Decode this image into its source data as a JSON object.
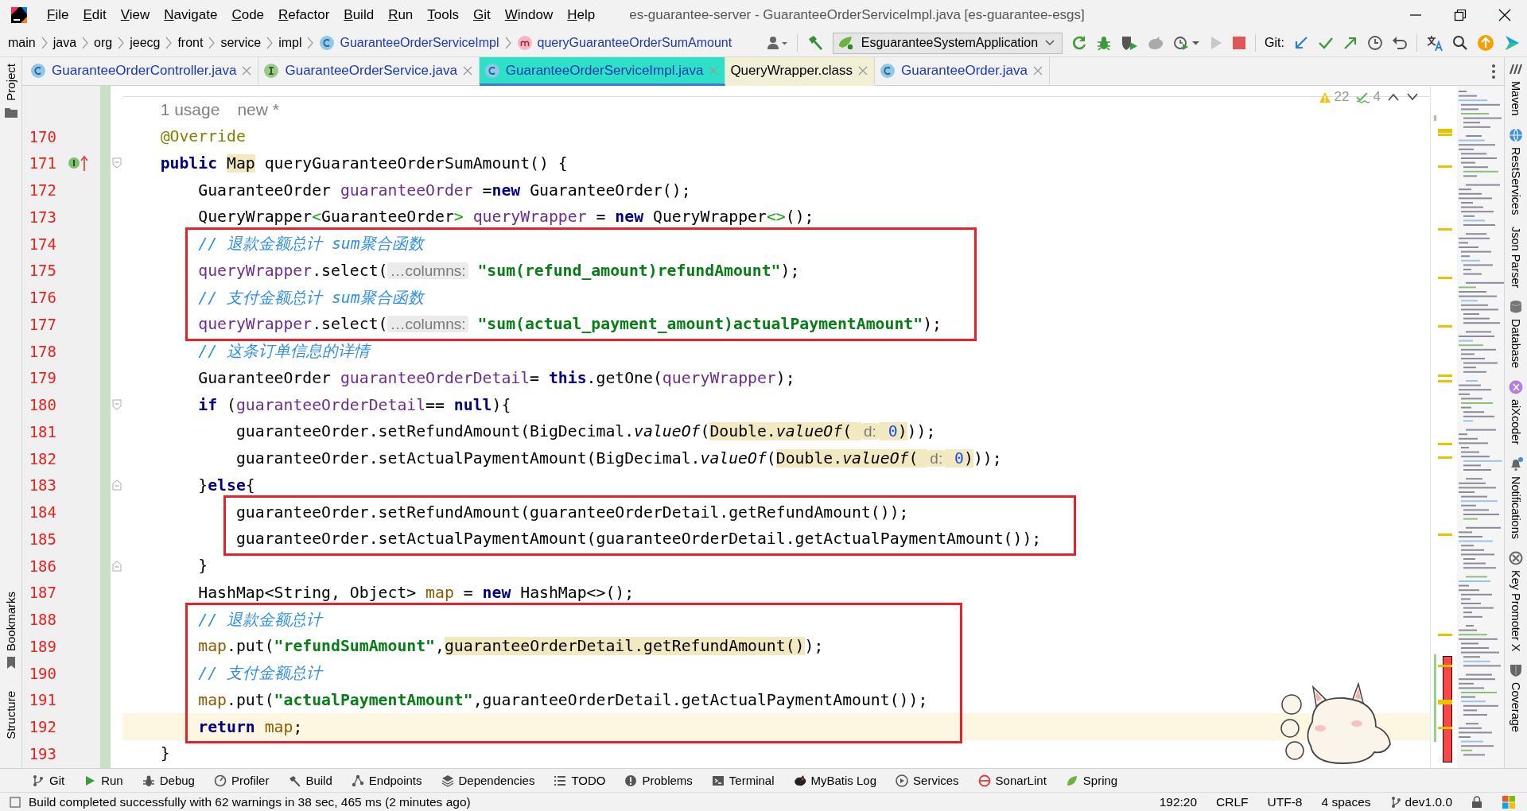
{
  "title_bar": {
    "menu": [
      "File",
      "Edit",
      "View",
      "Navigate",
      "Code",
      "Refactor",
      "Build",
      "Run",
      "Tools",
      "Git",
      "Window",
      "Help"
    ],
    "title": "es-guarantee-server - GuaranteeOrderServiceImpl.java [es-guarantee-esgs]"
  },
  "nav_bar": {
    "breadcrumbs": [
      {
        "label": "main",
        "kind": "package"
      },
      {
        "label": "java",
        "kind": "package"
      },
      {
        "label": "org",
        "kind": "package"
      },
      {
        "label": "jeecg",
        "kind": "package"
      },
      {
        "label": "front",
        "kind": "package"
      },
      {
        "label": "service",
        "kind": "package"
      },
      {
        "label": "impl",
        "kind": "package"
      },
      {
        "label": "GuaranteeOrderServiceImpl",
        "kind": "class"
      },
      {
        "label": "queryGuaranteeOrderSumAmount",
        "kind": "method"
      }
    ],
    "run_configuration": "EsguaranteeSystemApplication",
    "git_label": "Git:"
  },
  "tabs": [
    {
      "label": "GuaranteeOrderController.java",
      "kind": "class",
      "selected": false
    },
    {
      "label": "GuaranteeOrderService.java",
      "kind": "interface",
      "selected": false
    },
    {
      "label": "GuaranteeOrderServiceImpl.java",
      "kind": "class",
      "selected": true
    },
    {
      "label": "QueryWrapper.class",
      "kind": "library",
      "selected": false
    },
    {
      "label": "GuaranteeOrder.java",
      "kind": "class",
      "selected": false
    }
  ],
  "left_tool_windows": {
    "top": [
      {
        "label": "Project",
        "kind": "folder"
      }
    ],
    "bottom": [
      {
        "label": "Bookmarks",
        "kind": "bookmark"
      },
      {
        "label": "Structure",
        "kind": "plain"
      }
    ]
  },
  "right_tool_windows": [
    {
      "label": "Maven",
      "kind": "maven"
    },
    {
      "label": "RestServices",
      "kind": "globe"
    },
    {
      "label": "Json Parser",
      "kind": "plain"
    },
    {
      "label": "Database",
      "kind": "database"
    },
    {
      "label": "aiXcoder",
      "kind": "aix"
    },
    {
      "label": "Notifications",
      "kind": "bell"
    },
    {
      "label": "Key Promoter X",
      "kind": "key"
    },
    {
      "label": "Coverage",
      "kind": "shield"
    }
  ],
  "editor": {
    "inspections": {
      "warnings": "22",
      "weak_warnings": "4"
    },
    "usage_hint": [
      "1 usage",
      "new *"
    ],
    "code_blocks": [
      {
        "boxed": false,
        "lines": [
          {
            "number": "170",
            "kind": "plain",
            "current": false,
            "tokens": [
              {
                "kind": "annotation",
                "text": "    @Override"
              }
            ]
          },
          {
            "number": "171",
            "kind": "implements",
            "current": false,
            "tokens": [
              {
                "kind": "keyword",
                "text": "    public "
              },
              {
                "kind": "plain",
                "text": "Map",
                "highlighted": true
              },
              {
                "kind": "plain",
                "text": " queryGuaranteeOrderSumAmount() {"
              }
            ]
          },
          {
            "number": "172",
            "kind": "plain",
            "current": false,
            "tokens": [
              {
                "kind": "plain",
                "text": "        GuaranteeOrder "
              },
              {
                "kind": "variable",
                "text": "guaranteeOrder"
              },
              {
                "kind": "plain",
                "text": " ="
              },
              {
                "kind": "keyword",
                "text": "new"
              },
              {
                "kind": "plain",
                "text": " GuaranteeOrder();"
              }
            ]
          },
          {
            "number": "173",
            "kind": "plain",
            "current": false,
            "tokens": [
              {
                "kind": "plain",
                "text": "        QueryWrapper"
              },
              {
                "kind": "generic",
                "text": "<"
              },
              {
                "kind": "plain",
                "text": "GuaranteeOrder"
              },
              {
                "kind": "generic",
                "text": "> "
              },
              {
                "kind": "variable",
                "text": "queryWrapper"
              },
              {
                "kind": "plain",
                "text": " = "
              },
              {
                "kind": "keyword",
                "text": "new"
              },
              {
                "kind": "plain",
                "text": " QueryWrapper"
              },
              {
                "kind": "generic",
                "text": "<>"
              },
              {
                "kind": "plain",
                "text": "();"
              }
            ]
          }
        ]
      },
      {
        "boxed": true,
        "lines": [
          {
            "number": "174",
            "kind": "plain",
            "current": false,
            "tokens": [
              {
                "kind": "comment",
                "text": "        // 退款金额总计 sum聚合函数"
              }
            ]
          },
          {
            "number": "175",
            "kind": "plain",
            "current": false,
            "tokens": [
              {
                "kind": "variable",
                "text": "        queryWrapper"
              },
              {
                "kind": "plain",
                "text": ".select("
              },
              {
                "kind": "hint",
                "text": "…columns:"
              },
              {
                "kind": "string",
                "text": " \"sum(refund_amount)refundAmount\""
              },
              {
                "kind": "plain",
                "text": ");"
              }
            ]
          },
          {
            "number": "176",
            "kind": "plain",
            "current": false,
            "tokens": [
              {
                "kind": "comment",
                "text": "        // 支付金额总计 sum聚合函数"
              }
            ]
          },
          {
            "number": "177",
            "kind": "plain",
            "current": false,
            "tokens": [
              {
                "kind": "variable",
                "text": "        queryWrapper"
              },
              {
                "kind": "plain",
                "text": ".select("
              },
              {
                "kind": "hint",
                "text": "…columns:"
              },
              {
                "kind": "string",
                "text": " \"sum(actual_payment_amount)actualPaymentAmount\""
              },
              {
                "kind": "plain",
                "text": ");"
              }
            ]
          }
        ]
      },
      {
        "boxed": false,
        "lines": [
          {
            "number": "178",
            "kind": "plain",
            "current": false,
            "tokens": [
              {
                "kind": "comment",
                "text": "        // 这条订单信息的详情"
              }
            ]
          },
          {
            "number": "179",
            "kind": "plain",
            "current": false,
            "tokens": [
              {
                "kind": "plain",
                "text": "        GuaranteeOrder "
              },
              {
                "kind": "variable",
                "text": "guaranteeOrderDetail"
              },
              {
                "kind": "plain",
                "text": "= "
              },
              {
                "kind": "keyword",
                "text": "this"
              },
              {
                "kind": "plain",
                "text": ".getOne("
              },
              {
                "kind": "variable",
                "text": "queryWrapper"
              },
              {
                "kind": "plain",
                "text": ");"
              }
            ]
          },
          {
            "number": "180",
            "kind": "fold_start",
            "current": false,
            "tokens": [
              {
                "kind": "keyword",
                "text": "        if"
              },
              {
                "kind": "plain",
                "text": " ("
              },
              {
                "kind": "variable",
                "text": "guaranteeOrderDetail"
              },
              {
                "kind": "plain",
                "text": "== "
              },
              {
                "kind": "keyword",
                "text": "null"
              },
              {
                "kind": "plain",
                "text": "){"
              }
            ]
          },
          {
            "number": "181",
            "kind": "plain",
            "current": false,
            "tokens": [
              {
                "kind": "plain",
                "text": "            guaranteeOrder.setRefundAmount(BigDecimal."
              },
              {
                "kind": "static",
                "text": "valueOf"
              },
              {
                "kind": "plain",
                "text": "("
              },
              {
                "kind": "plain",
                "text": "Double.",
                "highlighted": true
              },
              {
                "kind": "static",
                "text": "valueOf",
                "highlighted": true
              },
              {
                "kind": "plain",
                "text": "( ",
                "highlighted": true
              },
              {
                "kind": "hint",
                "text": "d:",
                "highlighted": true
              },
              {
                "kind": "number",
                "text": " 0",
                "highlighted": true
              },
              {
                "kind": "plain",
                "text": ")",
                "highlighted": true
              },
              {
                "kind": "plain",
                "text": "));"
              }
            ]
          },
          {
            "number": "182",
            "kind": "plain",
            "current": false,
            "tokens": [
              {
                "kind": "plain",
                "text": "            guaranteeOrder.setActualPaymentAmount(BigDecimal."
              },
              {
                "kind": "static",
                "text": "valueOf"
              },
              {
                "kind": "plain",
                "text": "("
              },
              {
                "kind": "plain",
                "text": "Double.",
                "highlighted": true
              },
              {
                "kind": "static",
                "text": "valueOf",
                "highlighted": true
              },
              {
                "kind": "plain",
                "text": "( ",
                "highlighted": true
              },
              {
                "kind": "hint",
                "text": "d:",
                "highlighted": true
              },
              {
                "kind": "number",
                "text": " 0",
                "highlighted": true
              },
              {
                "kind": "plain",
                "text": ")",
                "highlighted": true
              },
              {
                "kind": "plain",
                "text": "));"
              }
            ]
          },
          {
            "number": "183",
            "kind": "fold_end",
            "current": false,
            "tokens": [
              {
                "kind": "plain",
                "text": "        }"
              },
              {
                "kind": "keyword",
                "text": "else"
              },
              {
                "kind": "plain",
                "text": "{"
              }
            ]
          }
        ]
      },
      {
        "boxed": true,
        "lines": [
          {
            "number": "184",
            "kind": "plain",
            "current": false,
            "tokens": [
              {
                "kind": "plain",
                "text": "            guaranteeOrder.setRefundAmount(guaranteeOrderDetail.getRefundAmount());"
              }
            ]
          },
          {
            "number": "185",
            "kind": "plain",
            "current": false,
            "tokens": [
              {
                "kind": "plain",
                "text": "            guaranteeOrder.setActualPaymentAmount(guaranteeOrderDetail.getActualPaymentAmount());"
              }
            ]
          }
        ]
      },
      {
        "boxed": false,
        "lines": [
          {
            "number": "186",
            "kind": "fold_end",
            "current": false,
            "tokens": [
              {
                "kind": "plain",
                "text": "        }"
              }
            ]
          },
          {
            "number": "187",
            "kind": "plain",
            "current": false,
            "tokens": [
              {
                "kind": "plain",
                "text": "        HashMap<String, Object> "
              },
              {
                "kind": "local",
                "text": "map"
              },
              {
                "kind": "plain",
                "text": " = "
              },
              {
                "kind": "keyword",
                "text": "new"
              },
              {
                "kind": "plain",
                "text": " HashMap<>();"
              }
            ]
          }
        ]
      },
      {
        "boxed": true,
        "lines": [
          {
            "number": "188",
            "kind": "plain",
            "current": false,
            "tokens": [
              {
                "kind": "comment",
                "text": "        // 退款金额总计"
              }
            ]
          },
          {
            "number": "189",
            "kind": "plain",
            "current": false,
            "tokens": [
              {
                "kind": "local",
                "text": "        map"
              },
              {
                "kind": "plain",
                "text": ".put("
              },
              {
                "kind": "string",
                "text": "\"refundSumAmount\""
              },
              {
                "kind": "plain",
                "text": ","
              },
              {
                "kind": "plain",
                "text": "guaranteeOrderDetail.getRefundAmount()",
                "highlighted": true
              },
              {
                "kind": "plain",
                "text": ");"
              }
            ]
          },
          {
            "number": "190",
            "kind": "plain",
            "current": false,
            "tokens": [
              {
                "kind": "comment",
                "text": "        // 支付金额总计"
              }
            ]
          },
          {
            "number": "191",
            "kind": "plain",
            "current": false,
            "tokens": [
              {
                "kind": "local",
                "text": "        map"
              },
              {
                "kind": "plain",
                "text": ".put("
              },
              {
                "kind": "string",
                "text": "\"actualPaymentAmount\""
              },
              {
                "kind": "plain",
                "text": ",guaranteeOrderDetail.getActualPaymentAmount());"
              }
            ]
          },
          {
            "number": "192",
            "kind": "plain",
            "current": true,
            "tokens": [
              {
                "kind": "keyword",
                "text": "        return "
              },
              {
                "kind": "local",
                "text": "map"
              },
              {
                "kind": "plain",
                "text": ";"
              }
            ]
          }
        ]
      },
      {
        "boxed": false,
        "lines": [
          {
            "number": "193",
            "kind": "plain",
            "current": false,
            "tokens": [
              {
                "kind": "plain",
                "text": "    }"
              }
            ]
          }
        ]
      }
    ]
  },
  "tool_bar": [
    {
      "label": "Git",
      "kind": "git"
    },
    {
      "label": "Run",
      "kind": "run"
    },
    {
      "label": "Debug",
      "kind": "debug"
    },
    {
      "label": "Profiler",
      "kind": "profiler"
    },
    {
      "label": "Build",
      "kind": "build"
    },
    {
      "label": "Endpoints",
      "kind": "endpoints"
    },
    {
      "label": "Dependencies",
      "kind": "dependencies"
    },
    {
      "label": "TODO",
      "kind": "todo"
    },
    {
      "label": "Problems",
      "kind": "problems"
    },
    {
      "label": "Terminal",
      "kind": "terminal"
    },
    {
      "label": "MyBatis Log",
      "kind": "mybatis"
    },
    {
      "label": "Services",
      "kind": "services"
    },
    {
      "label": "SonarLint",
      "kind": "sonarlint"
    },
    {
      "label": "Spring",
      "kind": "spring"
    }
  ],
  "status_bar": {
    "message": "Build completed successfully with 62 warnings in 38 sec, 465 ms (2 minutes ago)",
    "position": "192:20",
    "line_separator": "CRLF",
    "encoding": "UTF-8",
    "indent": "4 spaces",
    "branch": "dev1.0.0"
  }
}
